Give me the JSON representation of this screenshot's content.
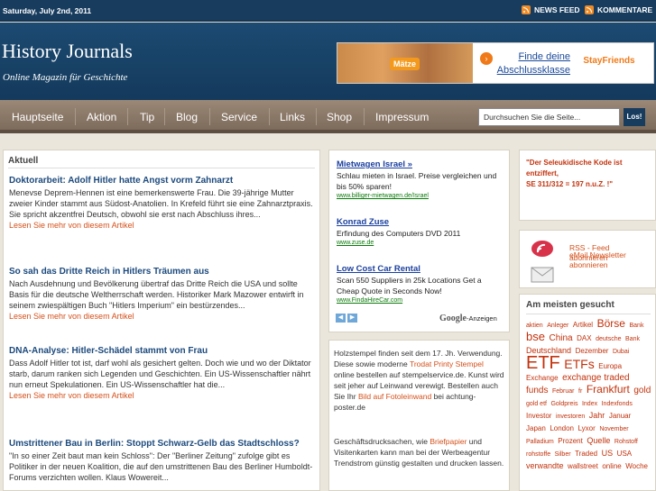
{
  "topbar": {
    "date": "Saturday, July 2nd, 2011",
    "newsfeed": "NEWS FEED",
    "comments": "KOMMENTARE"
  },
  "header": {
    "title": "History Journals",
    "tagline": "Online Magazin für Geschichte"
  },
  "banner": {
    "badge": "Mätze",
    "link": "Finde deine Abschlussklasse",
    "brand": "StayFriends"
  },
  "nav": {
    "items": [
      "Hauptseite",
      "Aktion",
      "Tip",
      "Blog",
      "Service",
      "Links",
      "Shop",
      "Impressum"
    ],
    "search_value": "Durchsuchen Sie die Seite...",
    "search_button": "Los!"
  },
  "main": {
    "title": "Aktuell",
    "articles": [
      {
        "title": "Doktorarbeit: Adolf Hitler hatte Angst vorm Zahnarzt",
        "body": "Menevse Deprem-Hennen ist eine bemerkenswerte Frau. Die 39-jährige Mutter zweier Kinder stammt aus Südost-Anatolien. In Krefeld führt sie eine Zahnarztpraxis. Sie spricht akzentfrei Deutsch, obwohl sie erst nach Abschluss ihres...",
        "more": "Lesen Sie mehr von diesem Artikel"
      },
      {
        "title": "So sah das Dritte Reich in Hitlers Träumen aus",
        "body": "Nach Ausdehnung und Bevölkerung übertraf das Dritte Reich die USA und sollte Basis für die deutsche Weltherrschaft werden. Historiker Mark Mazower entwirft in seinem zwiespältigen Buch \"Hitlers Imperium\" ein bestürzendes...",
        "more": "Lesen Sie mehr von diesem Artikel"
      },
      {
        "title": "DNA-Analyse: Hitler-Schädel stammt von Frau",
        "body": "Dass Adolf Hitler tot ist, darf wohl als gesichert gelten. Doch wie und wo der Diktator starb, darum ranken sich Legenden und Geschichten. Ein US-Wissenschaftler nährt nun erneut Spekulationen. Ein US-Wissenschaftler hat die...",
        "more": "Lesen Sie mehr von diesem Artikel"
      },
      {
        "title": "Umstrittener Bau in Berlin: Stoppt Schwarz-Gelb das Stadtschloss?",
        "body": "\"In so einer Zeit baut man kein Schloss\": Der \"Berliner Zeitung\" zufolge gibt es Politiker in der neuen Koalition, die auf den umstrittenen Bau des Berliner Humboldt-Forums verzichten wollen. Klaus Wowereit..."
      }
    ]
  },
  "ads": [
    {
      "title": "Mietwagen Israel »",
      "text": "Schlau mieten in Israel. Preise vergleichen und bis 50% sparen!",
      "url": "www.billiger-mietwagen.de/Israel"
    },
    {
      "title": "Konrad Zuse",
      "text": "Erfindung des Computers DVD 2011",
      "url": "www.zuse.de"
    },
    {
      "title": "Low Cost Car Rental",
      "text": "Scan 550 Suppliers in 25k Locations Get a Cheap Quote in Seconds Now!",
      "url": "www.FindaHireCar.com"
    }
  ],
  "ads_label": {
    "google": "Google",
    "suffix": "-Anzeigen"
  },
  "textads": {
    "p1": [
      "Holzstempel finden seit dem 17. Jh. Verwendung. Diese sowie moderne ",
      "Trodat Printy Stempel",
      " online bestellen auf stempelservice.de. Kunst wird seit jeher auf Leinwand verewigt. Bestellen auch Sie Ihr ",
      "Bild auf Fotoleinwand",
      " bei achtung-poster.de"
    ],
    "p2": [
      "Geschäftsdrucksachen, wie ",
      "Briefpapier",
      " und Visitenkarten kann man bei der Werbeagentur Trendstrom günstig gestalten und drucken lassen."
    ]
  },
  "quote": {
    "line1": "\"Der Seleukidische Kode ist entziffert,",
    "line2": "SE 311/312 = 197 n.u.Z. !\""
  },
  "feeds": {
    "rss": "RSS - Feed abonnieren",
    "email": "eMail Newsletter abonnieren"
  },
  "cloud": {
    "title": "Am meisten gesucht",
    "tags": [
      {
        "t": "aktien",
        "s": 7
      },
      {
        "t": "Anleger",
        "s": 7
      },
      {
        "t": "Artikel",
        "s": 8
      },
      {
        "t": "Börse",
        "s": 12
      },
      {
        "t": "Bank",
        "s": 7
      },
      {
        "t": "bse",
        "s": 13
      },
      {
        "t": "China",
        "s": 10
      },
      {
        "t": "DAX",
        "s": 8
      },
      {
        "t": "deutsche",
        "s": 7
      },
      {
        "t": "Bank",
        "s": 7
      },
      {
        "t": "Deutschland",
        "s": 9
      },
      {
        "t": "Dezember",
        "s": 8
      },
      {
        "t": "Dubai",
        "s": 7
      },
      {
        "t": "ETF",
        "s": 20
      },
      {
        "t": "ETFs",
        "s": 14
      },
      {
        "t": "Europa",
        "s": 8
      },
      {
        "t": "Exchange",
        "s": 8
      },
      {
        "t": "exchange traded",
        "s": 10
      },
      {
        "t": "funds",
        "s": 10
      },
      {
        "t": "Februar",
        "s": 7
      },
      {
        "t": "fr",
        "s": 7
      },
      {
        "t": "Frankfurt",
        "s": 12
      },
      {
        "t": "gold",
        "s": 10
      },
      {
        "t": "gold etf",
        "s": 7
      },
      {
        "t": "Goldpreis",
        "s": 7
      },
      {
        "t": "Index",
        "s": 7
      },
      {
        "t": "Indexfonds",
        "s": 7
      },
      {
        "t": "Investor",
        "s": 8
      },
      {
        "t": "investoren",
        "s": 7
      },
      {
        "t": "Jahr",
        "s": 9
      },
      {
        "t": "Januar",
        "s": 8
      },
      {
        "t": "Japan",
        "s": 8
      },
      {
        "t": "London",
        "s": 8
      },
      {
        "t": "Lyxor",
        "s": 8
      },
      {
        "t": "November",
        "s": 7
      },
      {
        "t": "Palladium",
        "s": 7
      },
      {
        "t": "Prozent",
        "s": 8
      },
      {
        "t": "Quelle",
        "s": 9
      },
      {
        "t": "Rohstoff",
        "s": 7
      },
      {
        "t": "rohstoffe",
        "s": 7
      },
      {
        "t": "Silber",
        "s": 7
      },
      {
        "t": "Traded",
        "s": 8
      },
      {
        "t": "US",
        "s": 9
      },
      {
        "t": "USA",
        "s": 8
      },
      {
        "t": "verwandte",
        "s": 9
      },
      {
        "t": "wallstreet",
        "s": 8
      },
      {
        "t": "online",
        "s": 8
      },
      {
        "t": "Woche",
        "s": 8
      }
    ]
  }
}
